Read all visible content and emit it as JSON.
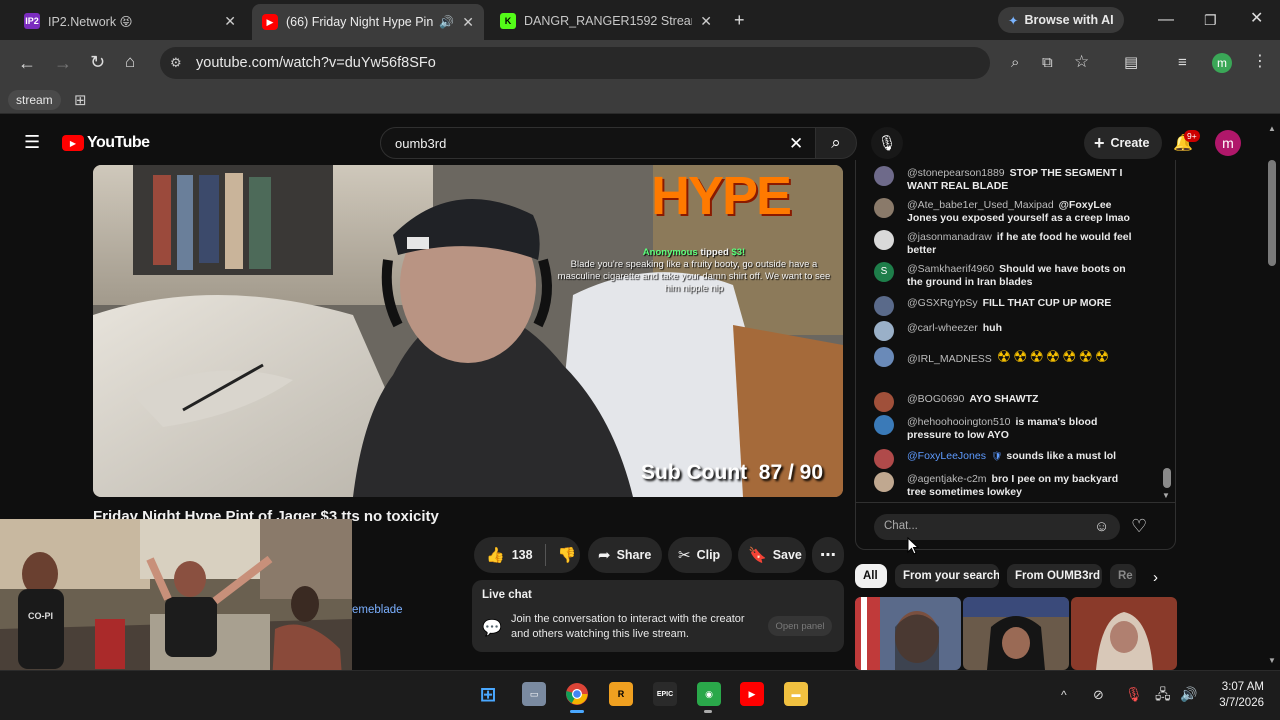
{
  "browser": {
    "tabs": [
      {
        "title": "IP2.Network 😝",
        "favicon": "IP2"
      },
      {
        "title": "(66) Friday Night Hype Pint",
        "favicon": "yt"
      },
      {
        "title": "DANGR_RANGER1592 Stream -",
        "favicon": "K"
      }
    ],
    "browse_ai_label": "Browse with AI",
    "url": "youtube.com/watch?v=duYw56f8SFo",
    "bookmark_label": "stream",
    "profile_initial": "m"
  },
  "youtube": {
    "logo_text": "YouTube",
    "search_value": "oumb3rd",
    "create_label": "Create",
    "notif_count": "9+",
    "avatar_initial": "m",
    "video": {
      "overlay_brand": "HYPE",
      "tip_name": "Anonymous",
      "tip_verb": "tipped",
      "tip_amount": "$3!",
      "tip_text": "Blade you're speaking like a fruity booty, go outside have a masculine cigarette and take your damn shirt off. We want to see him nipple nip",
      "sub_count": "Sub Count  87 / 90"
    },
    "title": "Friday Night Hype Pint of Jager $3 tts no toxicity",
    "channel_handle_fragment": "emeblade",
    "actions": {
      "likes": "138",
      "share": "Share",
      "clip": "Clip",
      "save": "Save"
    },
    "livechat_card": {
      "heading": "Live chat",
      "text": "Join the conversation to interact with the creator and others watching this live stream.",
      "button": "Open panel"
    },
    "chat": {
      "messages": [
        {
          "author": "@stonepearson1889",
          "text": "STOP THE SEGMENT I WANT REAL BLADE",
          "avatar_color": "#6e6a8a"
        },
        {
          "author": "@Ate_babe1er_Used_Maxipad",
          "text": "@FoxyLee Jones you exposed yourself as a creep lmao",
          "avatar_color": "#8a7a6a"
        },
        {
          "author": "@jasonmanadraw",
          "text": "if he ate food he would feel better",
          "avatar_color": "#d9d9d9"
        },
        {
          "author": "@Samkhaerif4960",
          "text": "Should we have boots on the ground in Iran blades",
          "avatar_color": "#1e7e4a",
          "initial": "S"
        },
        {
          "author": "@GSXRgYpSy",
          "text": "FILL THAT CUP UP MORE",
          "avatar_color": "#5a6a8a"
        },
        {
          "author": "@carl-wheezer",
          "text": "huh",
          "avatar_color": "#9ab0c8"
        },
        {
          "author": "@IRL_MADNESS",
          "text": "☢☢☢☢☢☢☢",
          "avatar_color": "#6a8ab8"
        },
        {
          "author": "@BOG0690",
          "text": "AYO SHAWTZ",
          "avatar_color": "#a0503a"
        },
        {
          "author": "@hehoohooington510",
          "text": "is mama's blood pressure to low AYO",
          "avatar_color": "#3a7ab8"
        },
        {
          "author": "@FoxyLeeJones",
          "text": "sounds like a must lol",
          "avatar_color": "#b04a4a"
        },
        {
          "author": "@agentjake-c2m",
          "text": "bro I pee on my backyard tree sometimes lowkey",
          "avatar_color": "#c0a890"
        }
      ],
      "input_placeholder": "Chat..."
    },
    "chips": [
      "All",
      "From your search",
      "From OUMB3rd",
      "Re"
    ]
  },
  "taskbar": {
    "time": "3:07 AM",
    "date": "3/7/2026"
  },
  "colors": {
    "yt_red": "#ff0000",
    "chrome_dark": "#1f1f1f",
    "chrome_toolbar": "#3c3c3c",
    "profile_green": "#3aa757",
    "avatar_magenta": "#b0176a"
  }
}
